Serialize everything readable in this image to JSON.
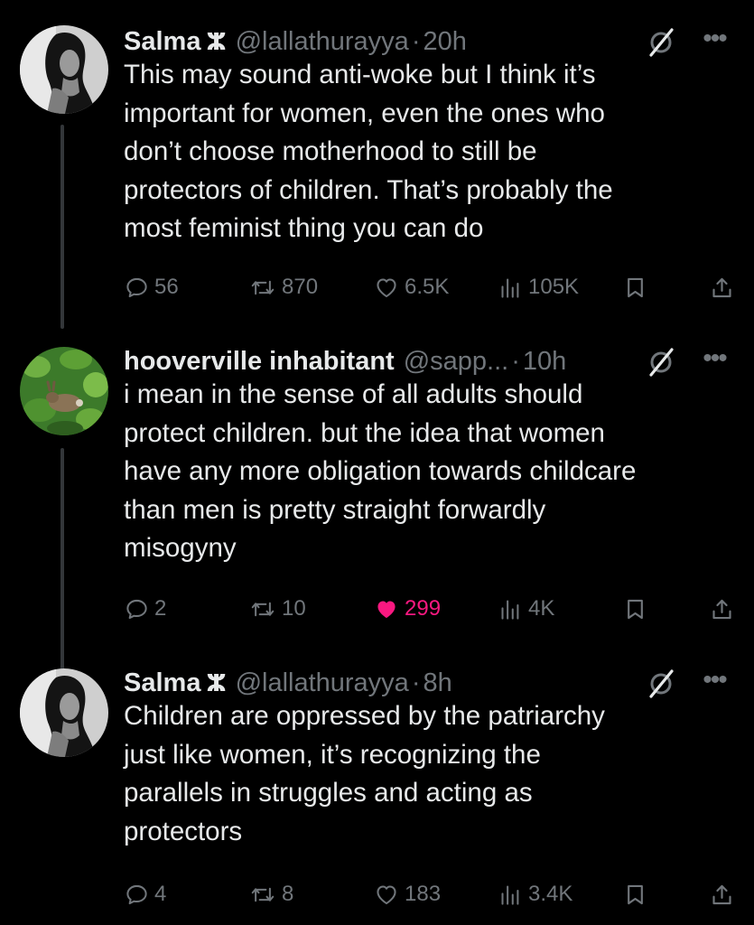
{
  "tweets": [
    {
      "name": "Salma",
      "name_symbol": "ⵣ",
      "handle": "@lallathurayya",
      "dot": "·",
      "time": "20h",
      "text": "This may sound anti-woke but I think it’s\nimportant for women, even the ones who\ndon’t choose motherhood to still be\nprotectors of children. That’s probably the\nmost feminist thing you can do",
      "replies": "56",
      "reposts": "870",
      "likes": "6.5K",
      "views": "105K",
      "liked": false
    },
    {
      "name": "hooverville inhabitant",
      "name_symbol": "",
      "handle": "@sapp...",
      "dot": "·",
      "time": "10h",
      "text": "i mean in the sense of all adults should\nprotect children. but the idea that women\nhave any more obligation towards childcare\nthan men is pretty straight forwardly\nmisogyny",
      "replies": "2",
      "reposts": "10",
      "likes": "299",
      "views": "4K",
      "liked": true
    },
    {
      "name": "Salma",
      "name_symbol": "ⵣ",
      "handle": "@lallathurayya",
      "dot": "·",
      "time": "8h",
      "text": "Children are oppressed by the patriarchy\njust like women, it’s recognizing the\nparallels in struggles and acting as\nprotectors",
      "replies": "4",
      "reposts": "8",
      "likes": "183",
      "views": "3.4K",
      "liked": false
    }
  ],
  "icons": {
    "reply": "reply-icon",
    "repost": "repost-icon",
    "like": "heart-icon",
    "views": "views-icon",
    "bookmark": "bookmark-icon",
    "share": "share-icon",
    "grok": "grok-icon",
    "more": "more-icon"
  },
  "colors": {
    "background": "#000000",
    "text": "#e7e9ea",
    "muted": "#71767b",
    "like_active": "#f91880",
    "thread_line": "#333639"
  }
}
